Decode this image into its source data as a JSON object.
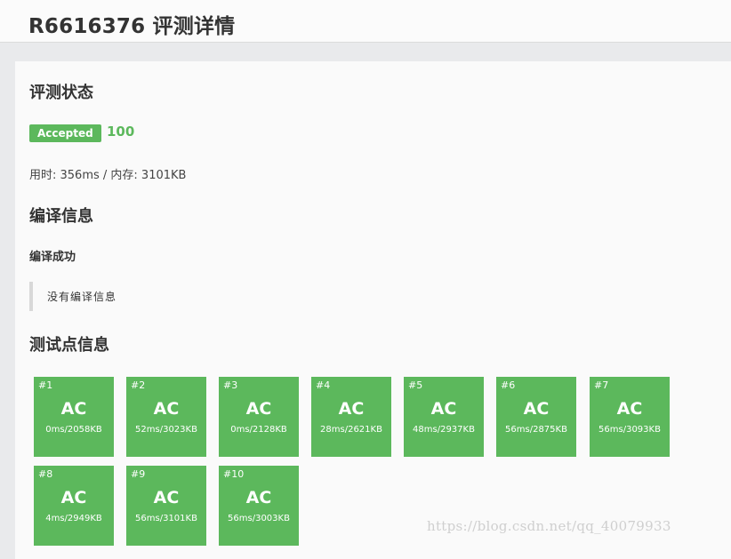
{
  "header": {
    "title": "R6616376 评测详情"
  },
  "status": {
    "heading": "评测状态",
    "badge": "Accepted",
    "score": "100",
    "stats": "用时: 356ms / 内存: 3101KB"
  },
  "compile": {
    "heading": "编译信息",
    "status": "编译成功",
    "message": "没有编译信息"
  },
  "tests": {
    "heading": "测试点信息",
    "items": [
      {
        "id": "#1",
        "result": "AC",
        "stat": "0ms/2058KB"
      },
      {
        "id": "#2",
        "result": "AC",
        "stat": "52ms/3023KB"
      },
      {
        "id": "#3",
        "result": "AC",
        "stat": "0ms/2128KB"
      },
      {
        "id": "#4",
        "result": "AC",
        "stat": "28ms/2621KB"
      },
      {
        "id": "#5",
        "result": "AC",
        "stat": "48ms/2937KB"
      },
      {
        "id": "#6",
        "result": "AC",
        "stat": "56ms/2875KB"
      },
      {
        "id": "#7",
        "result": "AC",
        "stat": "56ms/3093KB"
      },
      {
        "id": "#8",
        "result": "AC",
        "stat": "4ms/2949KB"
      },
      {
        "id": "#9",
        "result": "AC",
        "stat": "56ms/3101KB"
      },
      {
        "id": "#10",
        "result": "AC",
        "stat": "56ms/3003KB"
      }
    ]
  },
  "watermark": "https://blog.csdn.net/qq_40079933",
  "colors": {
    "accent": "#5cb85c",
    "background": "#e9eaec"
  }
}
